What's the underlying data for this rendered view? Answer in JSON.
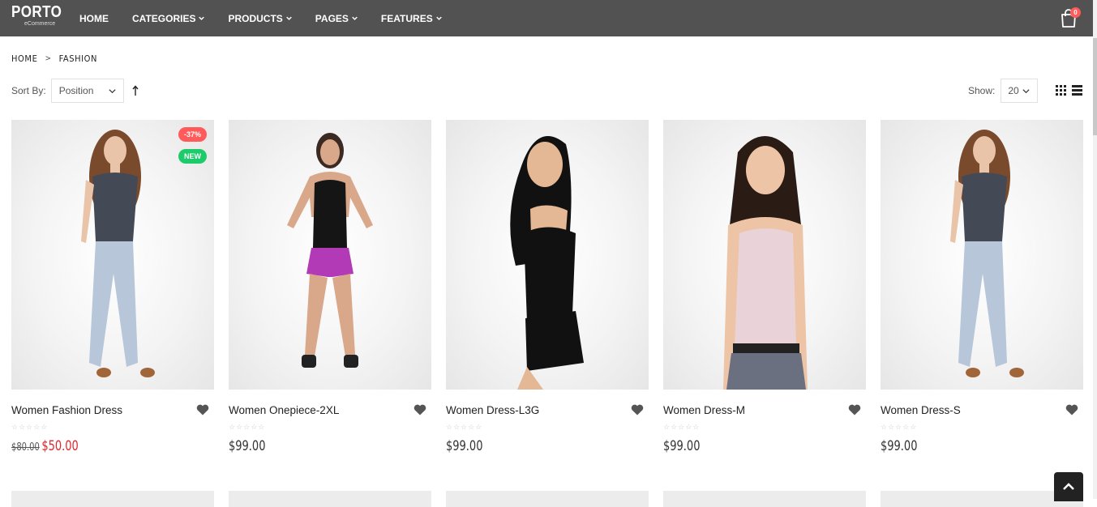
{
  "header": {
    "logo": {
      "brand": "PORTO",
      "sub": "eCommerce"
    },
    "nav": [
      {
        "label": "HOME",
        "has_dropdown": false
      },
      {
        "label": "CATEGORIES",
        "has_dropdown": true
      },
      {
        "label": "PRODUCTS",
        "has_dropdown": true
      },
      {
        "label": "PAGES",
        "has_dropdown": true
      },
      {
        "label": "FEATURES",
        "has_dropdown": true
      }
    ],
    "cart_count": "0",
    "colors": {
      "bar": "#525252",
      "badge": "#ff5b5b"
    }
  },
  "breadcrumb": {
    "home": "HOME",
    "separator": ">",
    "current": "FASHION"
  },
  "toolbar": {
    "sort_label": "Sort By:",
    "sort_value": "Position",
    "show_label": "Show:",
    "show_value": "20"
  },
  "products": [
    {
      "name": "Women Fashion Dress",
      "old_price": "$80.00",
      "price": "$50.00",
      "sale_badge": "-37%",
      "new_badge": "NEW",
      "rating": "☆☆☆☆☆"
    },
    {
      "name": "Women Onepiece-2XL",
      "price": "$99.00",
      "rating": "☆☆☆☆☆"
    },
    {
      "name": "Women Dress-L3G",
      "price": "$99.00",
      "rating": "☆☆☆☆☆"
    },
    {
      "name": "Women Dress-M",
      "price": "$99.00",
      "rating": "☆☆☆☆☆"
    },
    {
      "name": "Women Dress-S",
      "price": "$99.00",
      "rating": "☆☆☆☆☆"
    }
  ],
  "icons": {
    "cart": "shopping-bag-icon",
    "wishlist": "heart-icon",
    "sort_direction": "arrow-up-icon",
    "grid_view": "grid-icon",
    "list_view": "list-icon",
    "back_to_top": "chevron-up-icon"
  },
  "colors": {
    "sale_price": "#e3272e",
    "sale_badge": "#ff5b5b",
    "new_badge": "#1dcb6a"
  }
}
